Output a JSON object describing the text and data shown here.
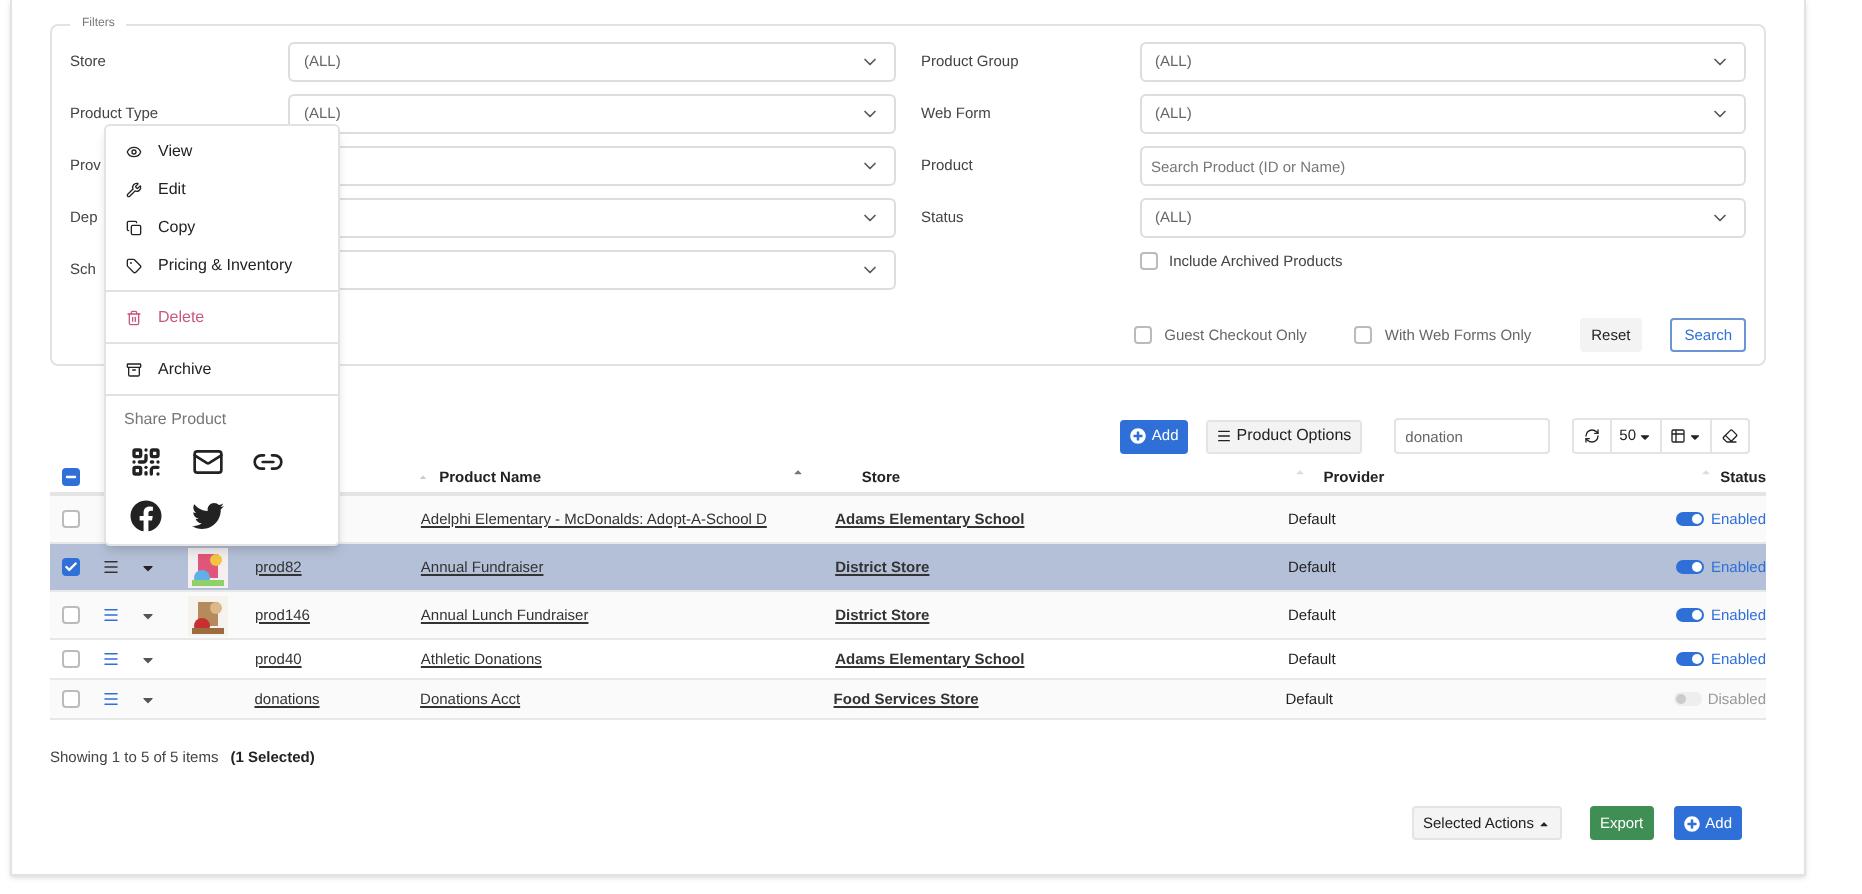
{
  "filters": {
    "legend": "Filters",
    "left": [
      {
        "label": "Store",
        "kind": "select",
        "value": "(ALL)"
      },
      {
        "label": "Product Type",
        "kind": "select",
        "value": "(ALL)"
      },
      {
        "label": "Prov",
        "kind": "select"
      },
      {
        "label": "Dep",
        "kind": "select"
      },
      {
        "label": "Sch",
        "kind": "select"
      }
    ],
    "right": [
      {
        "label": "Product Group",
        "kind": "select",
        "value": "(ALL)"
      },
      {
        "label": "Web Form",
        "kind": "select",
        "value": "(ALL)"
      },
      {
        "label": "Product",
        "kind": "text",
        "placeholder": "Search Product (ID or Name)"
      },
      {
        "label": "Status",
        "kind": "select",
        "value": "(ALL)"
      }
    ],
    "include_archived": {
      "label": "Include Archived Products",
      "checked": false
    },
    "options": [
      {
        "label": "Guest Checkout Only",
        "checked": false
      },
      {
        "label": "With Web Forms Only",
        "checked": false
      }
    ],
    "reset": "Reset",
    "search": "Search"
  },
  "menu": {
    "groups": [
      [
        {
          "label": "View",
          "danger": false
        },
        {
          "label": "Edit",
          "danger": false
        },
        {
          "label": "Copy",
          "danger": false
        },
        {
          "label": "Pricing & Inventory",
          "danger": false
        }
      ],
      [
        {
          "label": "Delete",
          "danger": true
        }
      ],
      [
        {
          "label": "Archive",
          "danger": false
        }
      ]
    ],
    "share_title": "Share Product"
  },
  "toolbar": {
    "add": "Add",
    "options": "Product Options",
    "search_value": "donation",
    "page_size": "50"
  },
  "table": {
    "header_indeterminate": true,
    "columns": [
      "Product Name",
      "Store",
      "Provider",
      "Status"
    ],
    "rows": [
      {
        "selected": false,
        "name": "Adelphi Elementary - McDonalds: Adopt-A-School D",
        "store": "Adams Elementary School",
        "provider": "Default",
        "enabled": true,
        "status": "Enabled"
      },
      {
        "selected": true,
        "id": "prod82",
        "image": true,
        "name": "Annual Fundraiser",
        "store": "District Store",
        "provider": "Default",
        "enabled": true,
        "status": "Enabled"
      },
      {
        "selected": false,
        "id": "prod146",
        "image": true,
        "name": "Annual Lunch Fundraiser",
        "store": "District Store",
        "provider": "Default",
        "enabled": true,
        "status": "Enabled"
      },
      {
        "selected": false,
        "id": "prod40",
        "image": false,
        "name": "Athletic Donations",
        "store": "Adams Elementary School",
        "provider": "Default",
        "enabled": true,
        "status": "Enabled"
      },
      {
        "selected": false,
        "id": "donations",
        "image": false,
        "name": "Donations Acct",
        "store": "Food Services Store",
        "provider": "Default",
        "enabled": false,
        "status": "Disabled"
      }
    ]
  },
  "footer": {
    "showing": "Showing 1 to 5 of 5 items",
    "selected": "(1 Selected)"
  },
  "actions": {
    "selected_actions": "Selected Actions",
    "export": "Export",
    "add": "Add"
  }
}
